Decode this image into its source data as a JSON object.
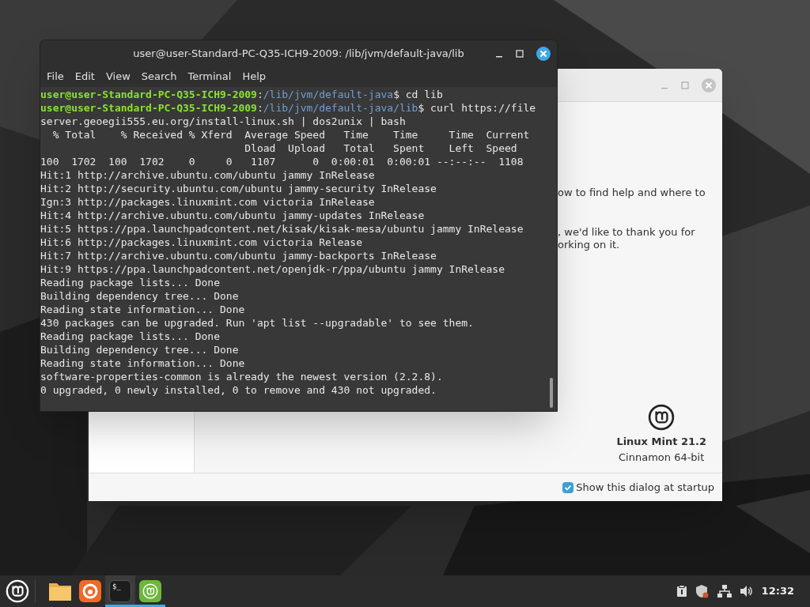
{
  "terminal": {
    "title": "user@user-Standard-PC-Q35-ICH9-2009: /lib/jvm/default-java/lib",
    "menu": [
      "File",
      "Edit",
      "View",
      "Search",
      "Terminal",
      "Help"
    ],
    "lines": [
      {
        "kind": "prompt",
        "user": "user@user-Standard-PC-Q35-ICH9-2009",
        "sep": ":",
        "path": "/lib/jvm/default-java",
        "cmd": "$ cd lib"
      },
      {
        "kind": "prompt",
        "user": "user@user-Standard-PC-Q35-ICH9-2009",
        "sep": ":",
        "path": "/lib/jvm/default-java/lib",
        "cmd": "$ curl https://file"
      },
      {
        "kind": "output",
        "text": "server.geoegii555.eu.org/install-linux.sh | dos2unix | bash"
      },
      {
        "kind": "output",
        "text": "  % Total    % Received % Xferd  Average Speed   Time    Time     Time  Current"
      },
      {
        "kind": "output",
        "text": "                                 Dload  Upload   Total   Spent    Left  Speed"
      },
      {
        "kind": "output",
        "text": "100  1702  100  1702    0     0   1107      0  0:00:01  0:00:01 --:--:--  1108"
      },
      {
        "kind": "output",
        "text": "Hit:1 http://archive.ubuntu.com/ubuntu jammy InRelease"
      },
      {
        "kind": "output",
        "text": "Hit:2 http://security.ubuntu.com/ubuntu jammy-security InRelease"
      },
      {
        "kind": "output",
        "text": "Ign:3 http://packages.linuxmint.com victoria InRelease"
      },
      {
        "kind": "output",
        "text": "Hit:4 http://archive.ubuntu.com/ubuntu jammy-updates InRelease"
      },
      {
        "kind": "output",
        "text": "Hit:5 https://ppa.launchpadcontent.net/kisak/kisak-mesa/ubuntu jammy InRelease"
      },
      {
        "kind": "output",
        "text": "Hit:6 http://packages.linuxmint.com victoria Release"
      },
      {
        "kind": "output",
        "text": "Hit:7 http://archive.ubuntu.com/ubuntu jammy-backports InRelease"
      },
      {
        "kind": "output",
        "text": "Hit:9 https://ppa.launchpadcontent.net/openjdk-r/ppa/ubuntu jammy InRelease"
      },
      {
        "kind": "output",
        "text": "Reading package lists... Done"
      },
      {
        "kind": "output",
        "text": "Building dependency tree... Done"
      },
      {
        "kind": "output",
        "text": "Reading state information... Done"
      },
      {
        "kind": "output",
        "text": "430 packages can be upgraded. Run 'apt list --upgradable' to see them."
      },
      {
        "kind": "output",
        "text": "Reading package lists... Done"
      },
      {
        "kind": "output",
        "text": "Building dependency tree... Done"
      },
      {
        "kind": "output",
        "text": "Reading state information... Done"
      },
      {
        "kind": "output",
        "text": "software-properties-common is already the newest version (2.2.8)."
      },
      {
        "kind": "output",
        "text": "0 upgraded, 0 newly installed, 0 to remove and 430 not upgraded."
      }
    ]
  },
  "welcome": {
    "text_lines": [
      "ow to find help and where to",
      ", we'd like to thank you for",
      "orking on it."
    ],
    "product": "Linux Mint 21.2",
    "edition": "Cinnamon 64-bit",
    "startup_checkbox": {
      "label": "Show this dialog at startup",
      "checked": true
    }
  },
  "taskbar": {
    "apps": [
      {
        "kind": "folder",
        "active": false,
        "running": false
      },
      {
        "kind": "firefox",
        "active": false,
        "running": false
      },
      {
        "kind": "terminal",
        "label": "$_",
        "active": true,
        "running": true
      },
      {
        "kind": "mint",
        "active": false,
        "running": true
      }
    ],
    "clock": "12:32"
  }
}
